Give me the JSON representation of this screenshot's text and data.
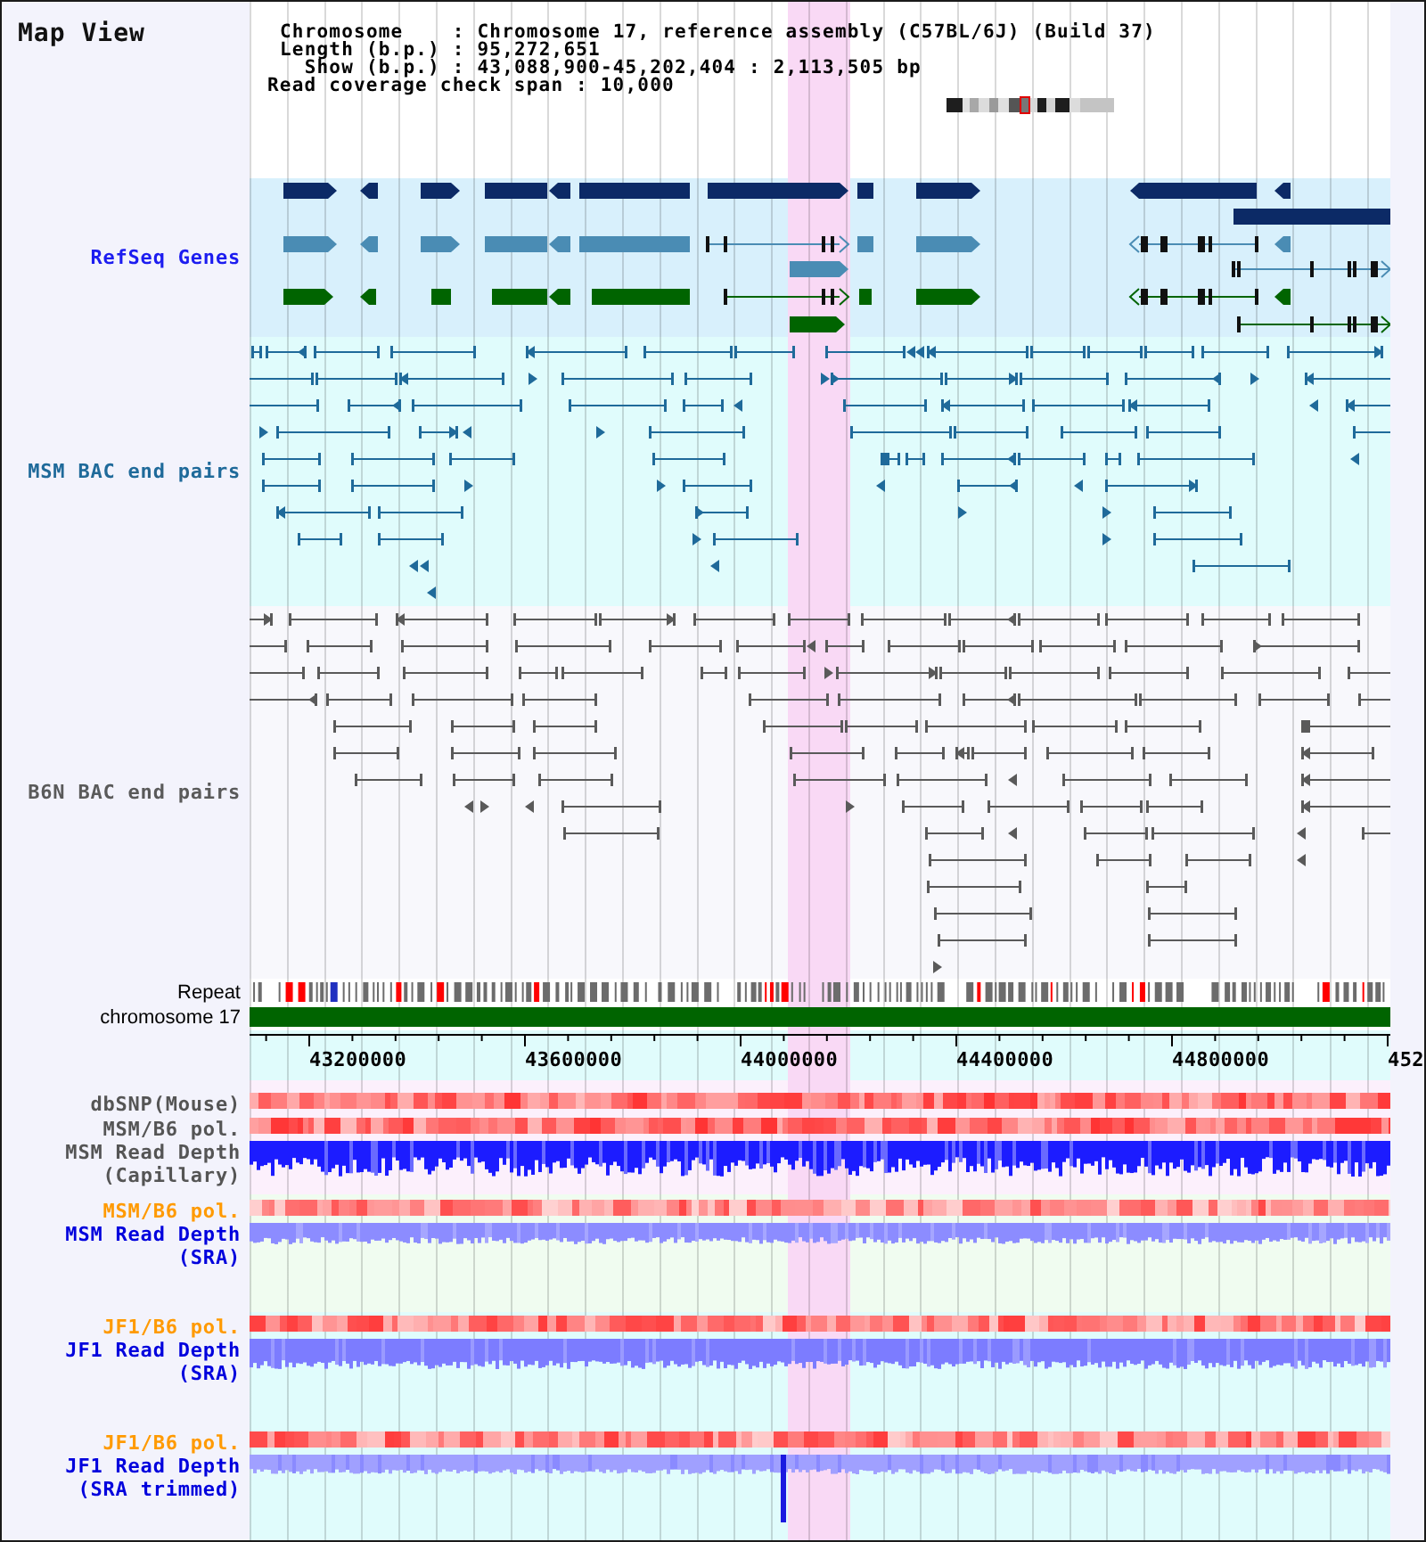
{
  "view": {
    "title": "Map View"
  },
  "info": {
    "lines": [
      "Chromosome    : Chromosome 17, reference assembly (C57BL/6J) (Build 37)",
      "Length (b.p.) : 95,272,651",
      "  Show (b.p.) : 43,088,900-45,202,404 : 2,113,505 bp"
    ],
    "coverage": "Read coverage check span : 10,000"
  },
  "feature_tracks": [
    {
      "kind": "genes",
      "label": "RefSeq Genes",
      "color": "#1c1cf0"
    },
    {
      "kind": "bac",
      "label": "MSM BAC end pairs",
      "color": "#1f6a9a"
    },
    {
      "kind": "bac",
      "label": "B6N BAC end pairs",
      "color": "#5a5a5a"
    }
  ],
  "overview_tracks": [
    {
      "kind": "repeat",
      "label": "Repeat"
    },
    {
      "kind": "chromosome",
      "label": "chromosome 17"
    }
  ],
  "ruler": {
    "labels": [
      "43200000",
      "43600000",
      "44000000",
      "44400000",
      "44800000",
      "452"
    ]
  },
  "data_panels": [
    {
      "tracks": [
        {
          "kind": "heat",
          "label": "dbSNP(Mouse)",
          "color": "#555555"
        },
        {
          "kind": "heat",
          "label": "MSM/B6 pol.",
          "color": "#555555"
        },
        {
          "kind": "depth",
          "label": "MSM Read Depth",
          "note": "(Capillary)",
          "color": "#555555"
        }
      ]
    },
    {
      "tracks": [
        {
          "kind": "heat",
          "label": "MSM/B6 pol.",
          "color": "#ff9a00"
        },
        {
          "kind": "depth",
          "label": "MSM Read Depth",
          "note": "(SRA)",
          "color": "#0000dd"
        }
      ]
    },
    {
      "tracks": [
        {
          "kind": "heat",
          "label": "JF1/B6 pol.",
          "color": "#ff9a00"
        },
        {
          "kind": "depth",
          "label": "JF1 Read Depth",
          "note": "(SRA)",
          "color": "#0000dd"
        }
      ]
    },
    {
      "tracks": [
        {
          "kind": "heat",
          "label": "JF1/B6 pol.",
          "color": "#ff9a00"
        },
        {
          "kind": "depth",
          "label": "JF1 Read Depth",
          "note": "(SRA trimmed)",
          "color": "#0000dd"
        }
      ]
    }
  ]
}
